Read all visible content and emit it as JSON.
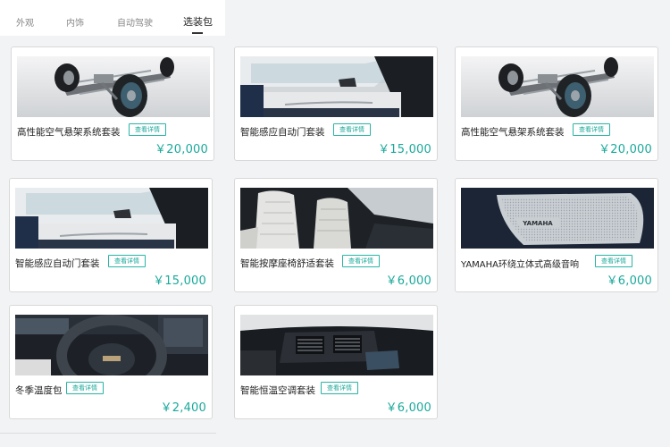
{
  "tabs": [
    {
      "label": "外观"
    },
    {
      "label": "内饰"
    },
    {
      "label": "自动驾驶"
    },
    {
      "label": "选装包",
      "active": true
    }
  ],
  "detail_label": "查看详情",
  "packages": [
    {
      "title": "高性能空气悬架系统套装",
      "price": "￥20,000",
      "icon": "chassis-image"
    },
    {
      "title": "智能感应自动门套装",
      "price": "￥15,000",
      "icon": "door-image"
    },
    {
      "title": "高性能空气悬架系统套装",
      "price": "￥20,000",
      "icon": "chassis-image"
    },
    {
      "title": "智能感应自动门套装",
      "price": "￥15,000",
      "icon": "door-image"
    },
    {
      "title": "智能按摩座椅舒适套装",
      "price": "￥6,000",
      "icon": "seat-image"
    },
    {
      "title": "YAMAHA环绕立体式高级音响",
      "price": "￥6,000",
      "icon": "speaker-image"
    },
    {
      "title": "冬季温度包",
      "price": "￥2,400",
      "icon": "steering-wheel-image"
    },
    {
      "title": "智能恒温空调套装",
      "price": "￥6,000",
      "icon": "air-vent-image"
    }
  ],
  "speaker_brand": "YAMAHA",
  "colors": {
    "accent": "#1aa99b",
    "background": "#f2f3f5",
    "card": "#ffffff"
  }
}
